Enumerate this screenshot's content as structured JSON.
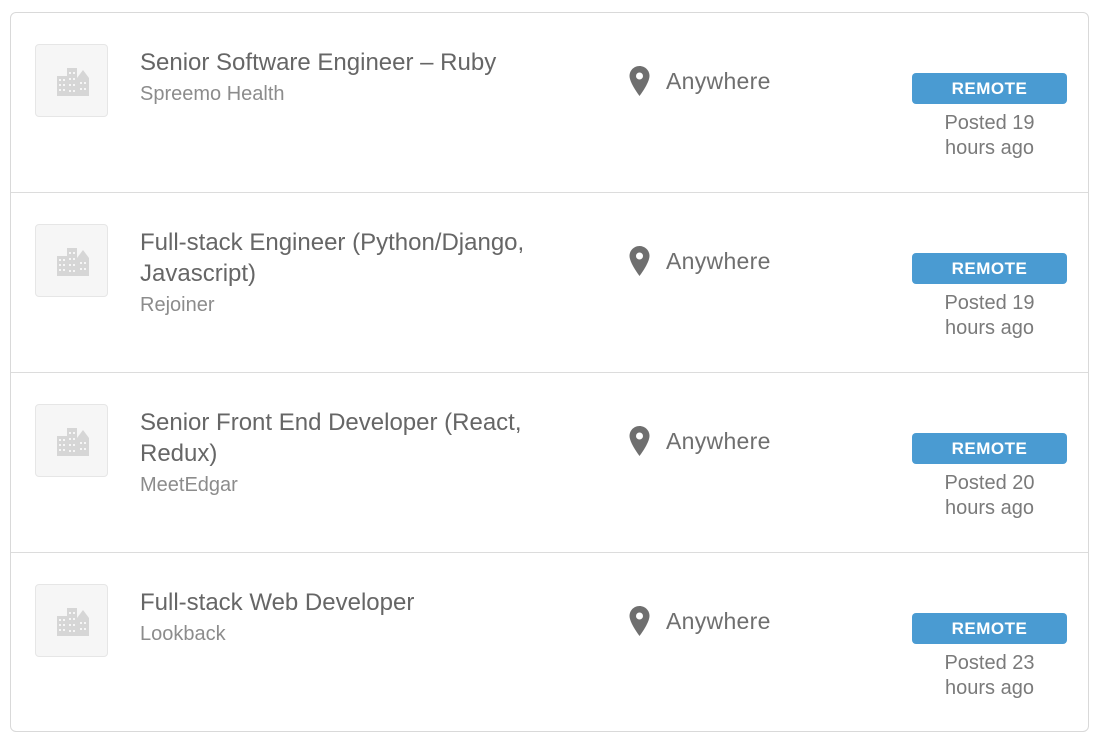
{
  "jobs": [
    {
      "title": "Senior Software Engineer – Ruby",
      "company": "Spreemo Health",
      "location": "Anywhere",
      "badge": "REMOTE",
      "posted_line1": "Posted 19",
      "posted_line2": "hours ago"
    },
    {
      "title": "Full-stack Engineer (Python/Django, Javascript)",
      "company": "Rejoiner",
      "location": "Anywhere",
      "badge": "REMOTE",
      "posted_line1": "Posted 19",
      "posted_line2": "hours ago"
    },
    {
      "title": "Senior Front End Developer (React, Redux)",
      "company": "MeetEdgar",
      "location": "Anywhere",
      "badge": "REMOTE",
      "posted_line1": "Posted 20",
      "posted_line2": "hours ago"
    },
    {
      "title": "Full-stack Web Developer",
      "company": "Lookback",
      "location": "Anywhere",
      "badge": "REMOTE",
      "posted_line1": "Posted 23",
      "posted_line2": "hours ago"
    }
  ],
  "icons": {
    "logo": "building-icon",
    "location": "map-pin-icon"
  },
  "colors": {
    "badge_bg": "#4a9bd2",
    "title_text": "#666666",
    "company_text": "#8c8c8c"
  }
}
